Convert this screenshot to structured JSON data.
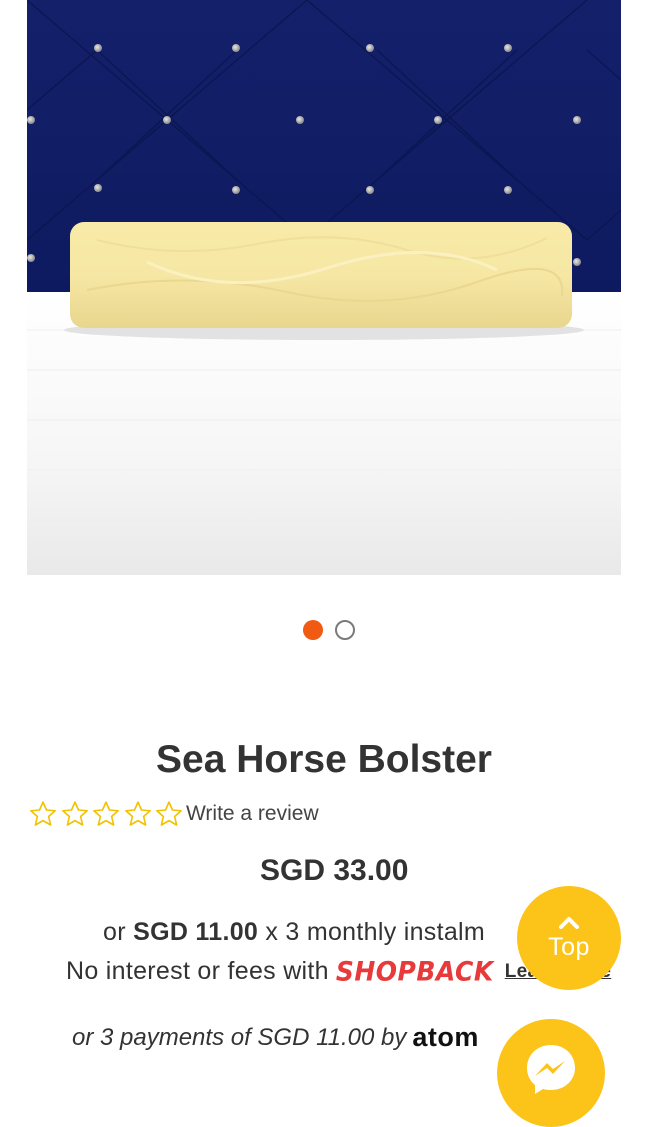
{
  "product": {
    "title": "Sea Horse Bolster",
    "price": "SGD 33.00",
    "image_icon": "bolster-on-bed-photo"
  },
  "carousel": {
    "slides": 2,
    "active_index": 0,
    "active_color": "#f05a12"
  },
  "rating": {
    "stars": 0,
    "max_stars": 5,
    "star_color": "#f2c200",
    "write_review_label": "Write a review"
  },
  "shopback": {
    "prefix": "or",
    "instalment_amount": "SGD 11.00",
    "instalment_suffix": "x 3 monthly instalm",
    "fees_text": "No interest or fees with",
    "logo_text": "SHOPBACK",
    "logo_color": "#e8393b",
    "learn_more_label": "Learn more"
  },
  "atome": {
    "text": "or 3 payments of SGD 11.00 by",
    "logo_text": "atom"
  },
  "floating": {
    "top_label": "Top",
    "top_icon": "chevron-up-icon",
    "messenger_icon": "messenger-icon",
    "button_color": "#fcc419"
  }
}
